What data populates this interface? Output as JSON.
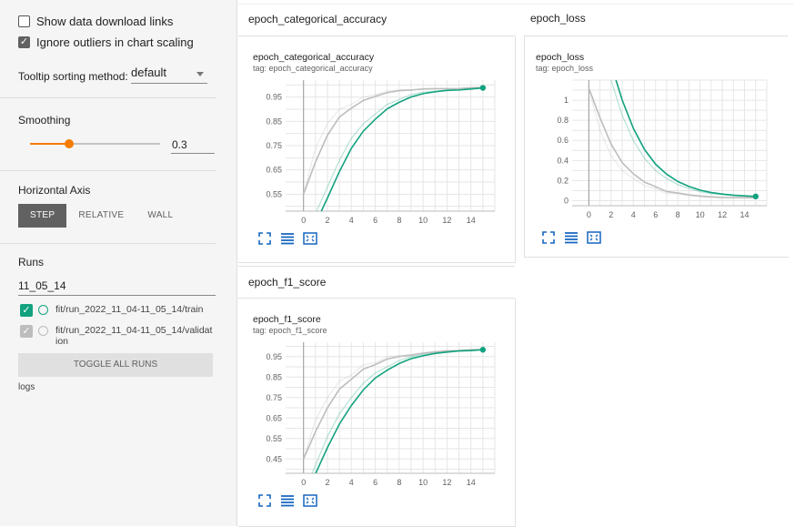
{
  "sidebar": {
    "show_download_label": "Show data download links",
    "ignore_outliers_label": "Ignore outliers in chart scaling",
    "tooltip_label": "Tooltip sorting method:",
    "tooltip_value": "default",
    "smoothing_label": "Smoothing",
    "smoothing_value": "0.3",
    "smoothing_fraction": 0.3,
    "horizontal_axis_label": "Horizontal Axis",
    "axis_options": [
      "STEP",
      "RELATIVE",
      "WALL"
    ],
    "runs_label": "Runs",
    "runs_filter": "11_05_14",
    "runs": [
      {
        "name": "fit/run_2022_11_04-11_05_14/train",
        "color": "#12a27f",
        "checked": true
      },
      {
        "name_line1": "fit/run_2022_11_04-11_05_14/validat",
        "name_line2": "ion",
        "color": "#bdbdbd",
        "checked": true
      }
    ],
    "toggle_all": "TOGGLE ALL RUNS",
    "logs_label": "logs"
  },
  "colors": {
    "train": "#12a27f",
    "validation": "#bdbdbd",
    "accent": "#f57c00"
  },
  "cards": {
    "acc": {
      "header": "epoch_categorical_accuracy",
      "title": "epoch_categorical_accuracy",
      "tag": "tag: epoch_categorical_accuracy"
    },
    "loss": {
      "header": "epoch_loss",
      "title": "epoch_loss",
      "tag": "tag: epoch_loss"
    },
    "f1": {
      "header": "epoch_f1_score",
      "title": "epoch_f1_score",
      "tag": "tag: epoch_f1_score"
    }
  },
  "chart_data": [
    {
      "type": "line",
      "title": "epoch_categorical_accuracy",
      "x": [
        0,
        1,
        2,
        3,
        4,
        5,
        6,
        7,
        8,
        9,
        10,
        11,
        12,
        13,
        14,
        15
      ],
      "xticks": [
        0,
        2,
        4,
        6,
        8,
        10,
        12,
        14
      ],
      "yticks": [
        0.55,
        0.65,
        0.75,
        0.85,
        0.95
      ],
      "ylim": [
        0.48,
        1.02
      ],
      "xlim": [
        -1.5,
        16
      ],
      "series": [
        {
          "name": "train",
          "values": [
            0.33,
            0.47,
            0.58,
            0.69,
            0.78,
            0.84,
            0.88,
            0.92,
            0.94,
            0.96,
            0.97,
            0.975,
            0.98,
            0.98,
            0.985,
            0.99
          ]
        },
        {
          "name": "validation",
          "values": [
            0.55,
            0.74,
            0.84,
            0.9,
            0.92,
            0.95,
            0.96,
            0.975,
            0.98,
            0.98,
            0.985,
            0.985,
            0.985,
            0.985,
            0.99,
            0.99
          ]
        }
      ]
    },
    {
      "type": "line",
      "title": "epoch_loss",
      "x": [
        0,
        1,
        2,
        3,
        4,
        5,
        6,
        7,
        8,
        9,
        10,
        11,
        12,
        13,
        14,
        15
      ],
      "xticks": [
        0,
        2,
        4,
        6,
        8,
        10,
        12,
        14
      ],
      "yticks": [
        0,
        0.2,
        0.4,
        0.6,
        0.8,
        1
      ],
      "ylim": [
        -0.05,
        1.2
      ],
      "xlim": [
        -1.5,
        16
      ],
      "series": [
        {
          "name": "train",
          "values": [
            2.0,
            1.6,
            1.2,
            0.85,
            0.6,
            0.42,
            0.3,
            0.22,
            0.16,
            0.12,
            0.09,
            0.07,
            0.06,
            0.05,
            0.045,
            0.04
          ]
        },
        {
          "name": "validation",
          "values": [
            1.12,
            0.7,
            0.45,
            0.3,
            0.22,
            0.15,
            0.12,
            0.07,
            0.07,
            0.05,
            0.04,
            0.035,
            0.03,
            0.03,
            0.03,
            0.03
          ]
        }
      ]
    },
    {
      "type": "line",
      "title": "epoch_f1_score",
      "x": [
        0,
        1,
        2,
        3,
        4,
        5,
        6,
        7,
        8,
        9,
        10,
        11,
        12,
        13,
        14,
        15
      ],
      "xticks": [
        0,
        2,
        4,
        6,
        8,
        10,
        12,
        14
      ],
      "yticks": [
        0.45,
        0.55,
        0.65,
        0.75,
        0.85,
        0.95
      ],
      "ylim": [
        0.38,
        1.02
      ],
      "xlim": [
        -1.5,
        16
      ],
      "series": [
        {
          "name": "train",
          "values": [
            0.28,
            0.42,
            0.56,
            0.67,
            0.75,
            0.82,
            0.87,
            0.9,
            0.93,
            0.95,
            0.96,
            0.97,
            0.975,
            0.98,
            0.98,
            0.985
          ]
        },
        {
          "name": "validation",
          "values": [
            0.45,
            0.64,
            0.75,
            0.83,
            0.86,
            0.91,
            0.92,
            0.95,
            0.955,
            0.96,
            0.97,
            0.975,
            0.98,
            0.98,
            0.985,
            0.985
          ]
        }
      ]
    }
  ]
}
